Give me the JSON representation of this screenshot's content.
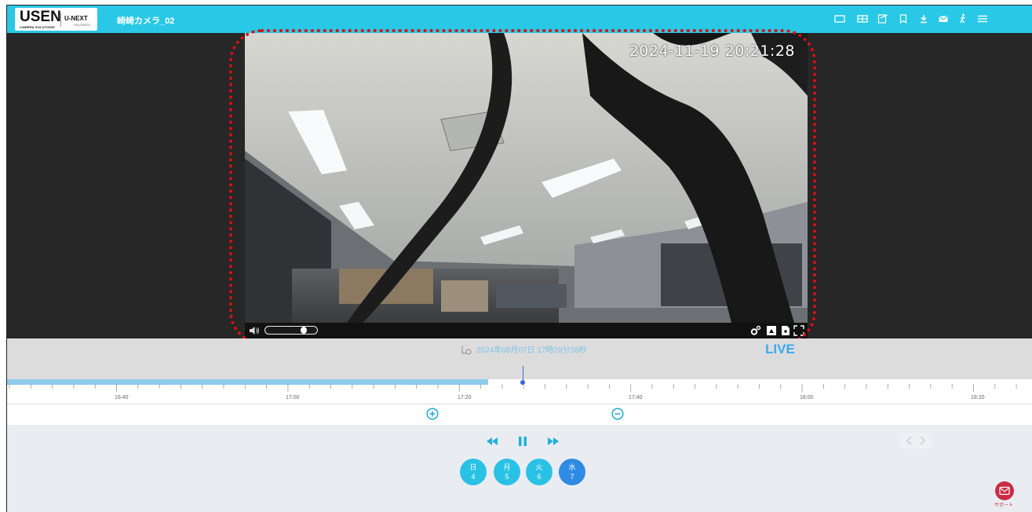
{
  "header": {
    "logo_main": "USEN",
    "logo_sub": "CAMERA SOLUTIONS",
    "logo_partner": "U-NEXT",
    "logo_partner_sub": "HOLDINGS",
    "camera_title": "崎崎カメラ_02",
    "icons": [
      "single-view-icon",
      "grid-view-icon",
      "edit-icon",
      "bookmark-icon",
      "download-icon",
      "mail-icon",
      "walking-person-icon",
      "menu-icon"
    ]
  },
  "video": {
    "timestamp": "2024-11-19 20:21:28",
    "volume_level": 0.78,
    "tools": [
      "settings-gear-icon",
      "snapshot-icon",
      "export-icon",
      "fullscreen-icon"
    ]
  },
  "recording": {
    "info_text": "2024年08月07日 17時29分38秒",
    "live_label": "LIVE"
  },
  "timeline": {
    "labels": [
      "16:40",
      "17:00",
      "17:20",
      "17:40",
      "18:00",
      "18:20"
    ],
    "recorded_until": "17:24",
    "cursor_time": "17:29"
  },
  "playback": {
    "controls": [
      "rewind-icon",
      "pause-icon",
      "fast-forward-icon"
    ]
  },
  "days": [
    {
      "weekday": "日",
      "date": "4",
      "selected": false
    },
    {
      "weekday": "月",
      "date": "5",
      "selected": false
    },
    {
      "weekday": "火",
      "date": "6",
      "selected": false
    },
    {
      "weekday": "水",
      "date": "7",
      "selected": true
    }
  ],
  "support": {
    "label": "サポート"
  },
  "colors": {
    "header": "#29c8e6",
    "day_button": "#29c2e4",
    "day_selected": "#2f8ae3",
    "live": "#3fa8f2",
    "annotation": "#d81010"
  }
}
